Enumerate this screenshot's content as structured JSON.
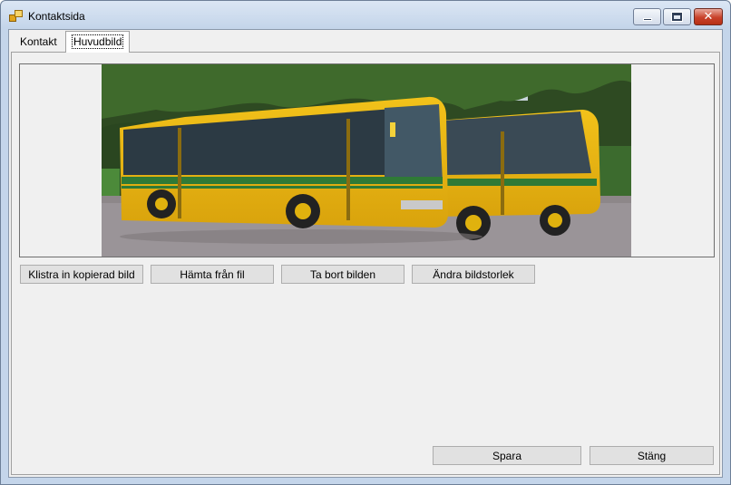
{
  "window": {
    "title": "Kontaktsida",
    "controls": {
      "minimize_icon": "minimize-icon",
      "maximize_icon": "maximize-icon",
      "close_icon": "close-icon",
      "close_glyph": "✕"
    },
    "colors": {
      "close": "#c8412a",
      "frame": "#c4d5ea"
    }
  },
  "tabs": [
    {
      "label": "Kontakt",
      "selected": false
    },
    {
      "label": "Huvudbild",
      "selected": true
    }
  ],
  "image_panel": {
    "content": "photo"
  },
  "image_buttons": {
    "paste": "Klistra in kopierad bild",
    "from_file": "Hämta från fil",
    "remove": "Ta bort bilden",
    "resize": "Ändra bildstorlek"
  },
  "footer": {
    "save": "Spara",
    "close": "Stäng"
  }
}
